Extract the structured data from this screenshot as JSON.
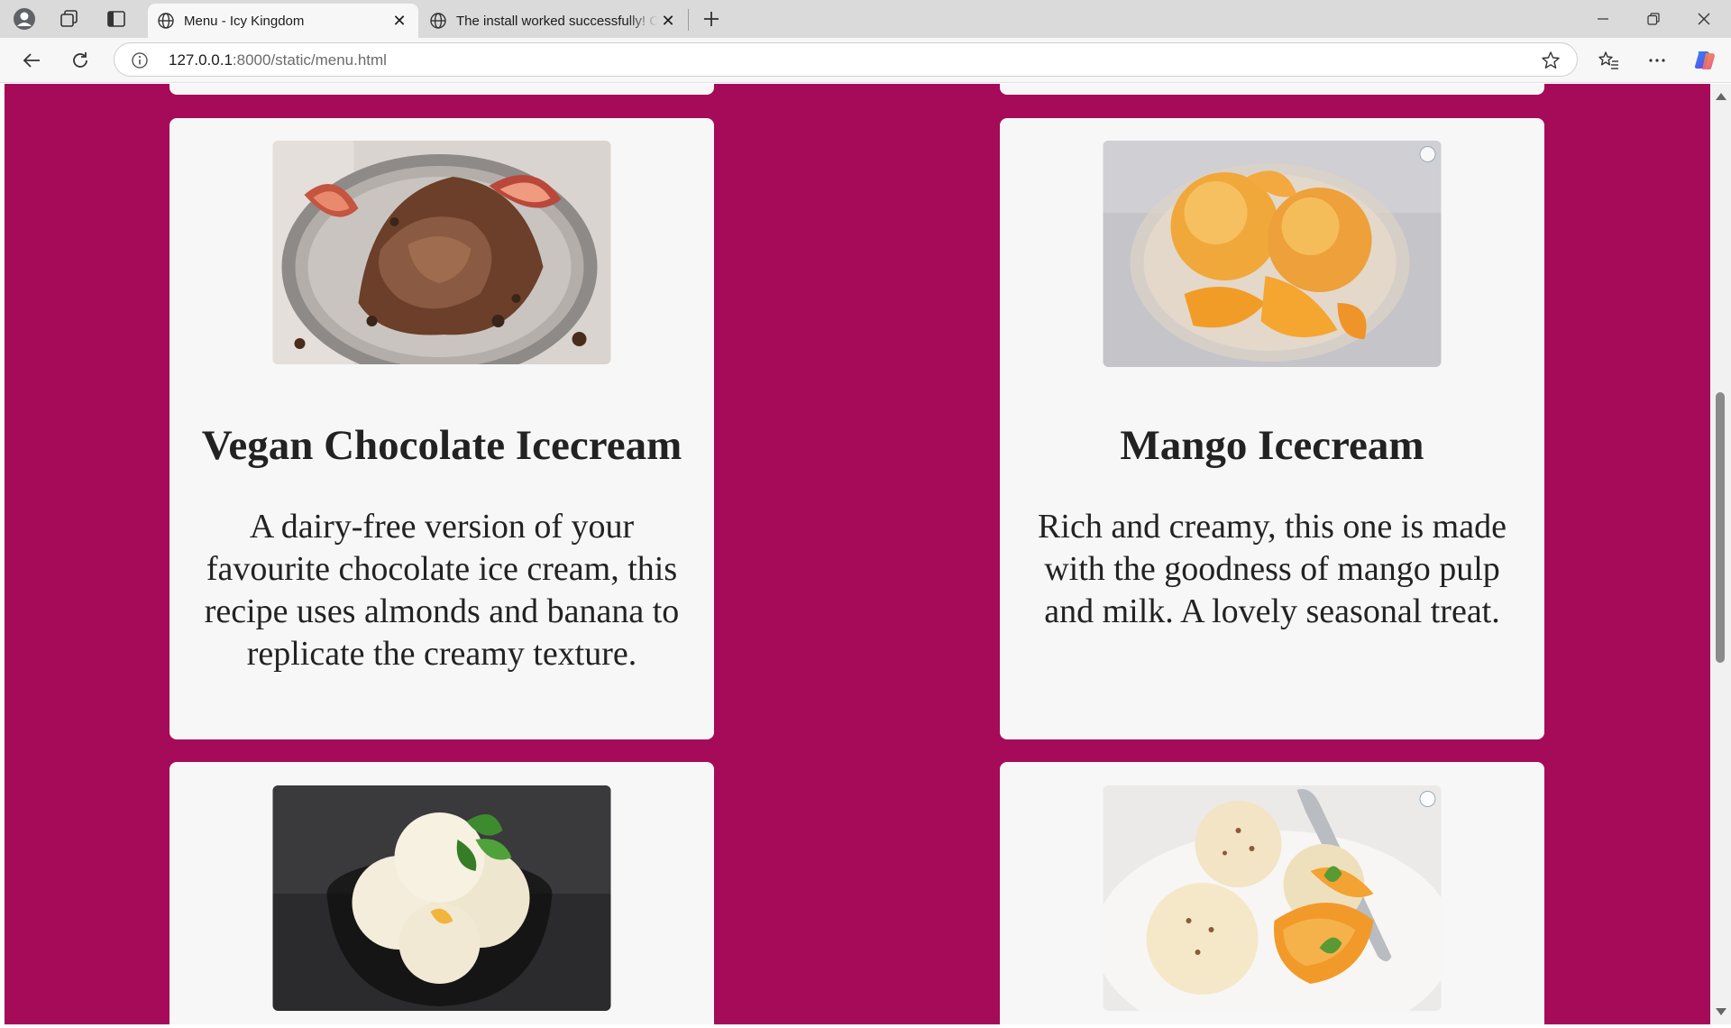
{
  "browser": {
    "tabs": [
      {
        "title": "Menu - Icy Kingdom",
        "active": true
      },
      {
        "title": "The install worked successfully! Congratulations!",
        "active": false
      }
    ],
    "address": {
      "host": "127.0.0.1",
      "rest": ":8000/static/menu.html"
    }
  },
  "page": {
    "background": "#a50b59",
    "cards": [
      {
        "title": "Vegan Chocolate Icecream",
        "description": "A dairy-free version of your favourite chocolate ice cream, this recipe uses almonds and banana to replicate the creamy texture.",
        "image_alt": "chocolate ice cream with figs"
      },
      {
        "title": "Mango Icecream",
        "description": "Rich and creamy, this one is made with the goodness of mango pulp and milk. A lovely seasonal treat.",
        "image_alt": "mango ice cream scoops in glass bowl"
      },
      {
        "image_alt": "vanilla ice cream with mint in black bowl"
      },
      {
        "image_alt": "vanilla ice cream with peaches and cinnamon"
      }
    ]
  }
}
